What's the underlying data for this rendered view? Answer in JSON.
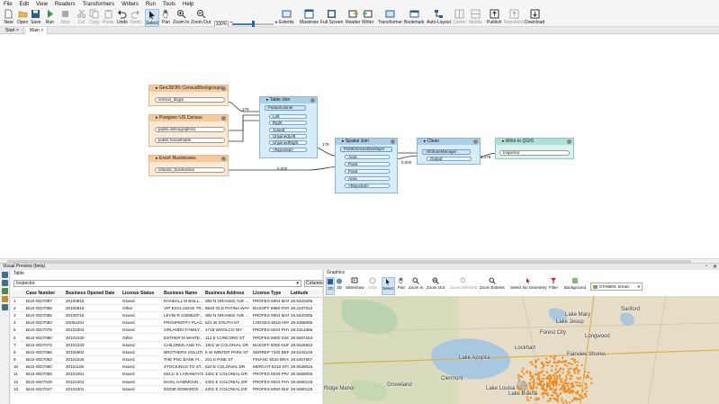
{
  "menu": [
    "File",
    "Edit",
    "View",
    "Readers",
    "Transformers",
    "Writers",
    "Run",
    "Tools",
    "Help"
  ],
  "toolbar": {
    "buttons": [
      "New",
      "Open",
      "Save",
      "Run",
      "Stop",
      "Cut",
      "Copy",
      "Paste",
      "Undo",
      "Redo",
      "Select",
      "Pan",
      "Zoom In",
      "Zoom Out",
      "Extents",
      "Maximize",
      "Full Screen",
      "Reader",
      "Writer",
      "Transformer",
      "Bookmark",
      "Auto-Layout",
      "Center",
      "Middle",
      "Publish",
      "Republish",
      "Download"
    ],
    "zoom_value": "100%"
  },
  "tabs": [
    "Start",
    "Main"
  ],
  "canvas": {
    "readers": [
      {
        "title": "GeoJSON::CensusBlockgroups",
        "ports": [
          "census_bkgrp"
        ]
      },
      {
        "title": "Postgres::US Census",
        "ports": [
          "public.demographics",
          "public.households"
        ]
      },
      {
        "title": "Excel::Businesses",
        "ports": [
          "orlando_businesses"
        ]
      }
    ],
    "table_join": {
      "title": "Table Join",
      "transformer": "FeatureJoiner",
      "ports": [
        "Left",
        "Right",
        "Joined",
        "UnjoinedLeft",
        "UnjoinedRight",
        "<Rejected>"
      ]
    },
    "spatial_join": {
      "title": "Spatial Join",
      "transformer": "PointOnAreaOverlayer",
      "ports": [
        "Area",
        "Point",
        "Point",
        "Area",
        "<Rejected>"
      ]
    },
    "clean": {
      "title": "Clean",
      "transformer": "AttributeManager",
      "ports": [
        "Output"
      ]
    },
    "writer": {
      "title": "Write to QGIS",
      "ports": [
        "Inspector"
      ]
    },
    "counts": {
      "c1": "178",
      "c2": "178",
      "c3": "5,000",
      "c4": "5,000",
      "c5": "5,178"
    }
  },
  "visual_preview": {
    "title": "Visual Preview (beta)",
    "table_label": "Table",
    "inspector_value": "Inspector",
    "columns_button": "Columns...",
    "columns": [
      "",
      "Case Number",
      "Business Opened Date",
      "License Status",
      "Business Name",
      "Business Address",
      "License Type",
      "Latitude"
    ],
    "rows": [
      [
        "1",
        "BUS-0027087",
        "20100816",
        "Issued",
        "RANDALL M BOLL...",
        "390 N ORANGE AVE ...",
        "PROFES 8004 MAP ...",
        "28.5420265"
      ],
      [
        "2",
        "BUS-0027088",
        "20100916",
        "Other",
        "VIP EXCLUSIVE TR...",
        "9620 OLD PATINA WAY",
        "BUSOFF 9980 PAR...",
        "28.4237012"
      ],
      [
        "3",
        "BUS-0027085",
        "20100716",
        "Issued",
        "LEVIN R GOMEZ/F...",
        "390 N ORANGE AVE ...",
        "PROFES 9004 MAP ...",
        "28.5420265"
      ],
      [
        "4",
        "BUS-0027083",
        "20051201",
        "Issued",
        "PROSPERITY PLAC...",
        "621 W SOUTH ST",
        "LODGES 8518 APAR...",
        "28.5358065"
      ],
      [
        "5",
        "BUS-0027079",
        "20101001",
        "Issued",
        "ORLANDO FAMILY ...",
        "1718 WOOLCO WY",
        "PROFES 8043 PHYS...",
        "28.5313466"
      ],
      [
        "6",
        "BUS-0027080",
        "20101020",
        "Other",
        "ESTHER M WHITE...",
        "112 E CONCORD ST",
        "PROFES 8080 SOCI...",
        "28.5507153"
      ],
      [
        "7",
        "BUS-0027074",
        "20101020",
        "Issued",
        "CHILDREN AND FA...",
        "1901 W COLONIAL DR",
        "BUSOFF 8050 NUR...",
        "28.5528943"
      ],
      [
        "8",
        "BUS-0027066",
        "20100902",
        "Issued",
        "BROTHERS SOLUTI...",
        "5 W WINTER PARK ST",
        "SERREP 7340 BER...",
        "28.5343145"
      ],
      [
        "9",
        "BUS-0027063",
        "20101025",
        "Issued",
        "THE PNC BANK FI...",
        "201 E PINE ST",
        "FINANC 6020 BRAN...",
        "28.5407667"
      ],
      [
        "10",
        "BUS-0027060",
        "20101106",
        "Issued",
        "STOCKINGS TO ST...",
        "520 E COLONIAL DR",
        "MERCHT 5315 STO...",
        "28.5539016"
      ],
      [
        "11",
        "BUS-0027058",
        "20101001",
        "Issued",
        "KELLI E LARAWAY/S...",
        "4301 E COLONIAL DR",
        "PROFES 8049 PRA...",
        "28.5559006"
      ],
      [
        "12",
        "BUS-0027049",
        "20101001",
        "Issued",
        "BASIL HAMMOUD...",
        "4301 E COLONIAL DR",
        "PROFES 8043 PHYS...",
        "28.5590126"
      ],
      [
        "13",
        "BUS-0027047",
        "20101001",
        "Issued",
        "EDDIE EDWARDS ...",
        "4301 E COLONIAL DR",
        "PROFES 8050 NURS...",
        "28.5590126"
      ]
    ]
  },
  "graphics": {
    "label": "Graphics",
    "buttons": [
      "2D",
      "3D",
      "Slideshow",
      "Orbit",
      "Select",
      "Pan",
      "Zoom In",
      "Zoom Out",
      "Zoom Selected",
      "Zoom Extents",
      "Select No Geometry",
      "Filter",
      "Background"
    ],
    "basemap": "STAMEN: terrain",
    "map_labels": [
      "Lake Mary",
      "Longwood",
      "Sanford",
      "Forest City",
      "Fairview Shores",
      "Lockhart",
      "Lake Apopka",
      "Clermont",
      "Groveland",
      "Ridge Manor",
      "Lake Louisa",
      "Lake Buena",
      "Lake Jesup"
    ]
  },
  "colors": {
    "accent": "#3a7bd5",
    "reader": "#f5c99a",
    "transformer": "#a9d0e8",
    "writer": "#ace1d7",
    "points": "#f28a1f"
  }
}
